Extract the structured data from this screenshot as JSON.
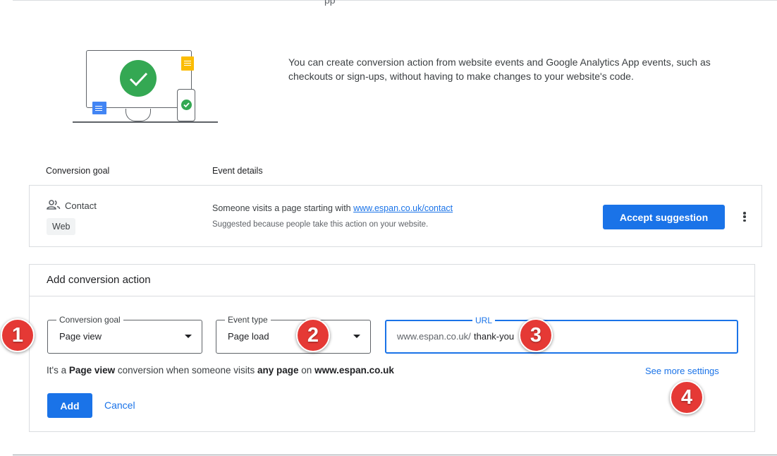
{
  "top": {
    "glyph": "pp"
  },
  "intro": {
    "text": "You can create conversion action from website events and Google Analytics App events, such as checkouts or sign-ups, without having to make changes to your website's code."
  },
  "columns": {
    "goal": "Conversion goal",
    "details": "Event details"
  },
  "suggestion": {
    "name": "Contact",
    "chip": "Web",
    "desc_prefix": "Someone visits a page starting with ",
    "desc_link": "www.espan.co.uk/contact",
    "sub": "Suggested because people take this action on your website.",
    "accept_label": "Accept suggestion",
    "more_icon": "more-vert-icon"
  },
  "add_form": {
    "title": "Add conversion action",
    "goal_label": "Conversion goal",
    "goal_value": "Page view",
    "event_label": "Event type",
    "event_value": "Page load",
    "url_label": "URL",
    "url_prefix": "www.espan.co.uk/",
    "url_value": "thank-you",
    "helper_1": "It's a ",
    "helper_goal": "Page view",
    "helper_2": " conversion when someone visits ",
    "helper_scope": "any page",
    "helper_3": " on ",
    "helper_domain": "www.espan.co.uk",
    "see_more": "See more settings",
    "add_label": "Add",
    "cancel_label": "Cancel"
  },
  "badges": [
    "1",
    "2",
    "3",
    "4"
  ],
  "colors": {
    "primary": "#1a73e8",
    "badge": "#e53935",
    "success": "#34a853",
    "note_yellow": "#fbbc04",
    "note_blue": "#4285f4"
  }
}
